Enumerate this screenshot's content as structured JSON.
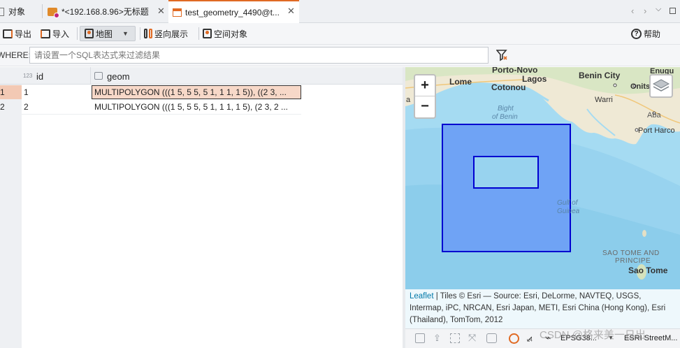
{
  "tabs": [
    {
      "label": "对象"
    },
    {
      "label": "*<192.168.8.96>无标题"
    },
    {
      "label": "test_geometry_4490@t..."
    }
  ],
  "toolbar": {
    "export_label": "导出",
    "import_label": "导入",
    "map_label": "地图",
    "vertical_label": "竖向展示",
    "spatial_label": "空间对象",
    "help_label": "帮助"
  },
  "filter": {
    "where_label": "WHERE:",
    "placeholder": "请设置一个SQL表达式来过滤结果"
  },
  "grid": {
    "columns": [
      {
        "type_tag": "123",
        "name": "id"
      },
      {
        "name": "geom"
      }
    ],
    "rows": [
      {
        "num": "1",
        "id": "1",
        "geom": "MULTIPOLYGON (((1 5, 5 5, 5 1, 1 1, 1 5)), ((2 3, ..."
      },
      {
        "num": "2",
        "id": "2",
        "geom": "MULTIPOLYGON (((1 5, 5 5, 5 1, 1 1, 1 5), (2 3, 2 ..."
      }
    ]
  },
  "map": {
    "zoom_in": "+",
    "zoom_out": "−",
    "places": {
      "porto_novo": "Porto-Novo",
      "lome": "Lome",
      "lagos": "Lagos",
      "cotonou": "Cotonou",
      "benin_city": "Benin City",
      "enugu": "Enugu",
      "onitsha": "Onits",
      "warri": "Warri",
      "aba": "Aba",
      "port_harcourt": "Port Harco",
      "bight_1": "Bight",
      "bight_2": "of Benin",
      "gulf_1": "Gulf of",
      "gulf_2": "Guinea",
      "sao_tome_region_1": "SAO TOME AND",
      "sao_tome_region_2": "PRINCIPE",
      "sao_tome": "Sao Tome",
      "edge_a": "a"
    },
    "attribution": {
      "leaflet": "Leaflet",
      "text": " | Tiles © Esri — Source: Esri, DeLorme, NAVTEQ, USGS, Intermap, iPC, NRCAN, Esri Japan, METI, Esri China (Hong Kong), Esri (Thailand), TomTom, 2012"
    },
    "crs_label": "EPSG38...",
    "basemap_label": "ESRI StreetM...",
    "watermark": "CSDN @格来美一日出",
    "colors": {
      "polygon_fill": "#6fa3f5",
      "polygon_stroke": "#0000d0",
      "hole_fill": "#a5dbf2"
    }
  }
}
